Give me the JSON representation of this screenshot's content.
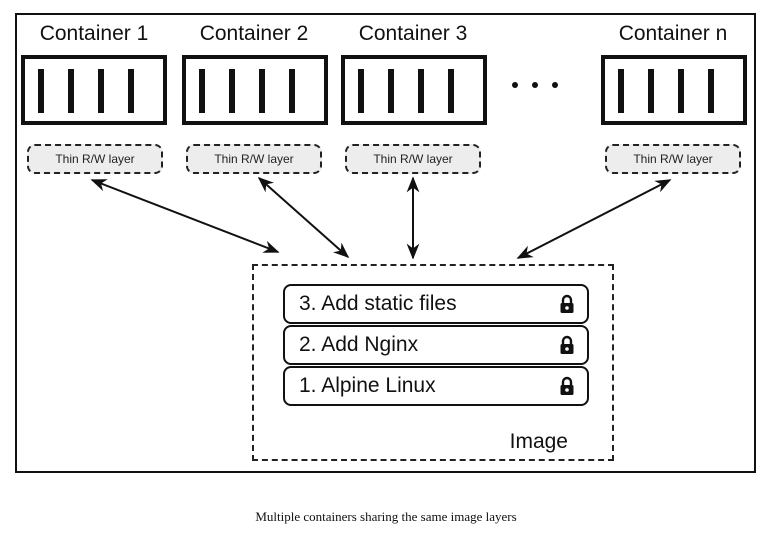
{
  "diagram": {
    "containers": [
      {
        "title": "Container 1",
        "layer_label": "Thin R/W layer"
      },
      {
        "title": "Container 2",
        "layer_label": "Thin R/W layer"
      },
      {
        "title": "Container 3",
        "layer_label": "Thin R/W layer"
      },
      {
        "title": "Container n",
        "layer_label": "Thin R/W layer"
      }
    ],
    "ellipsis": "...",
    "image": {
      "label": "Image",
      "layers": [
        {
          "label": "3. Add static files",
          "icon": "lock-icon"
        },
        {
          "label": "2. Add Nginx",
          "icon": "lock-icon"
        },
        {
          "label": "1. Alpine Linux",
          "icon": "lock-icon"
        }
      ]
    },
    "connections": [
      {
        "from": "Container 1",
        "to": "Image",
        "direction": "bidirectional"
      },
      {
        "from": "Container 2",
        "to": "Image",
        "direction": "bidirectional"
      },
      {
        "from": "Container 3",
        "to": "Image",
        "direction": "bidirectional"
      },
      {
        "from": "Container n",
        "to": "Image",
        "direction": "bidirectional"
      }
    ]
  },
  "caption": "Multiple containers sharing the same image layers"
}
